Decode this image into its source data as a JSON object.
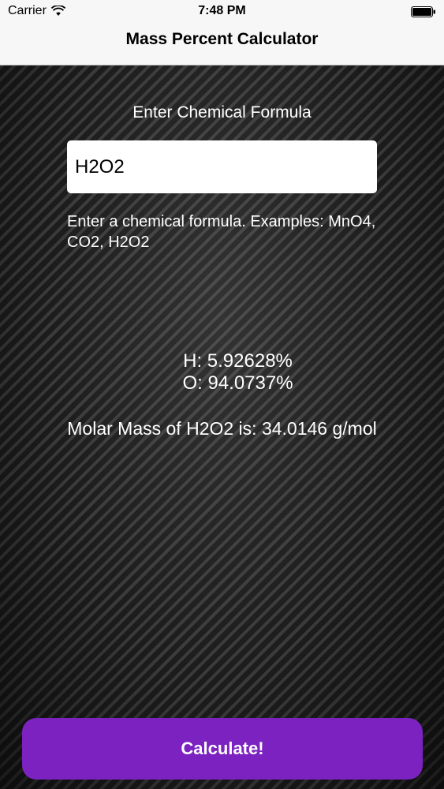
{
  "status_bar": {
    "carrier": "Carrier",
    "time": "7:48 PM",
    "wifi_icon": "wifi-icon",
    "battery_icon": "battery-icon"
  },
  "nav": {
    "title": "Mass Percent Calculator"
  },
  "form": {
    "prompt_label": "Enter Chemical Formula",
    "formula_value": "H2O2",
    "hint": "Enter a chemical formula. Examples: MnO4, CO2, H2O2"
  },
  "results": {
    "percentages": [
      {
        "text": "H: 5.92628%"
      },
      {
        "text": "O: 94.0737%"
      }
    ],
    "molar_mass_text": "Molar Mass of H2O2 is: 34.0146 g/mol"
  },
  "actions": {
    "calculate_label": "Calculate!"
  },
  "colors": {
    "accent": "#7b22c0",
    "nav_background": "#f7f7f7",
    "content_background": "#2a2a2a"
  }
}
